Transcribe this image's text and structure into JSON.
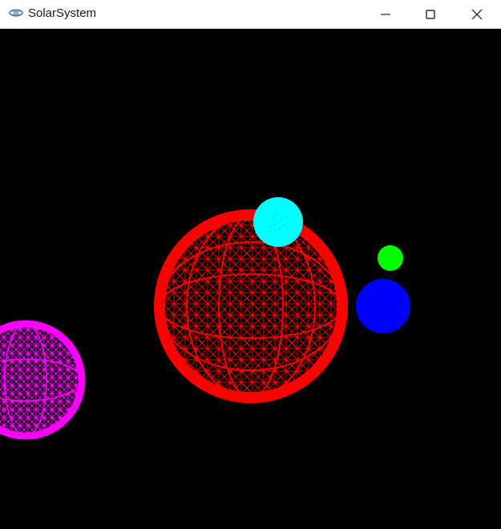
{
  "window": {
    "title": "SolarSystem",
    "app_icon": "orbit-app-icon",
    "controls": {
      "minimize_icon": "minimize-icon",
      "maximize_icon": "maximize-icon",
      "close_icon": "close-icon"
    }
  },
  "scene": {
    "background": "#000000",
    "bodies": [
      {
        "name": "sun",
        "color": "#ff0000",
        "render": "wireframe-sphere"
      },
      {
        "name": "cyan-planet",
        "color": "#00ffff",
        "render": "solid-sphere"
      },
      {
        "name": "green-planet",
        "color": "#00ff00",
        "render": "solid-sphere"
      },
      {
        "name": "blue-planet",
        "color": "#0000ff",
        "render": "solid-sphere"
      },
      {
        "name": "magenta-planet",
        "color": "#ff00ff",
        "render": "wireframe-sphere"
      }
    ]
  }
}
